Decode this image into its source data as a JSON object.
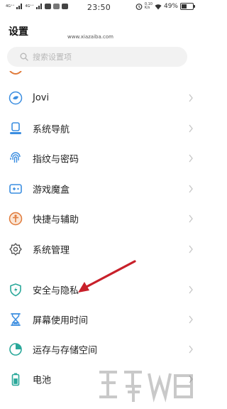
{
  "status_bar": {
    "signal_1": "4G⁺⁺",
    "signal_2": "4G⁺⁺",
    "time": "23:50",
    "speed_value": "0.10",
    "speed_unit": "K/s",
    "battery_percent": "49%",
    "battery_level": 0.49
  },
  "header": {
    "title": "设置"
  },
  "search": {
    "placeholder": "搜索设置项"
  },
  "items": [
    {
      "label": "Jovi",
      "icon": "jovi-icon",
      "color": "#3a8de0"
    },
    {
      "label": "系统导航",
      "icon": "navigation-icon",
      "color": "#3a8de0"
    },
    {
      "label": "指纹与密码",
      "icon": "fingerprint-icon",
      "color": "#3a8de0"
    },
    {
      "label": "游戏魔盒",
      "icon": "game-box-icon",
      "color": "#3a8de0"
    },
    {
      "label": "快捷与辅助",
      "icon": "accessibility-icon",
      "color": "#e07a3a"
    },
    {
      "label": "系统管理",
      "icon": "gear-icon",
      "color": "#555555"
    },
    {
      "label": "安全与隐私",
      "icon": "shield-icon",
      "color": "#2aa89a"
    },
    {
      "label": "屏幕使用时间",
      "icon": "hourglass-icon",
      "color": "#3a8de0"
    },
    {
      "label": "运存与存储空间",
      "icon": "storage-icon",
      "color": "#2aa89a"
    },
    {
      "label": "电池",
      "icon": "battery-icon",
      "color": "#2aa89a"
    }
  ],
  "watermark": {
    "text": "www.xiazaiba.com"
  },
  "annotation": {
    "arrow_color": "#c8202a"
  }
}
